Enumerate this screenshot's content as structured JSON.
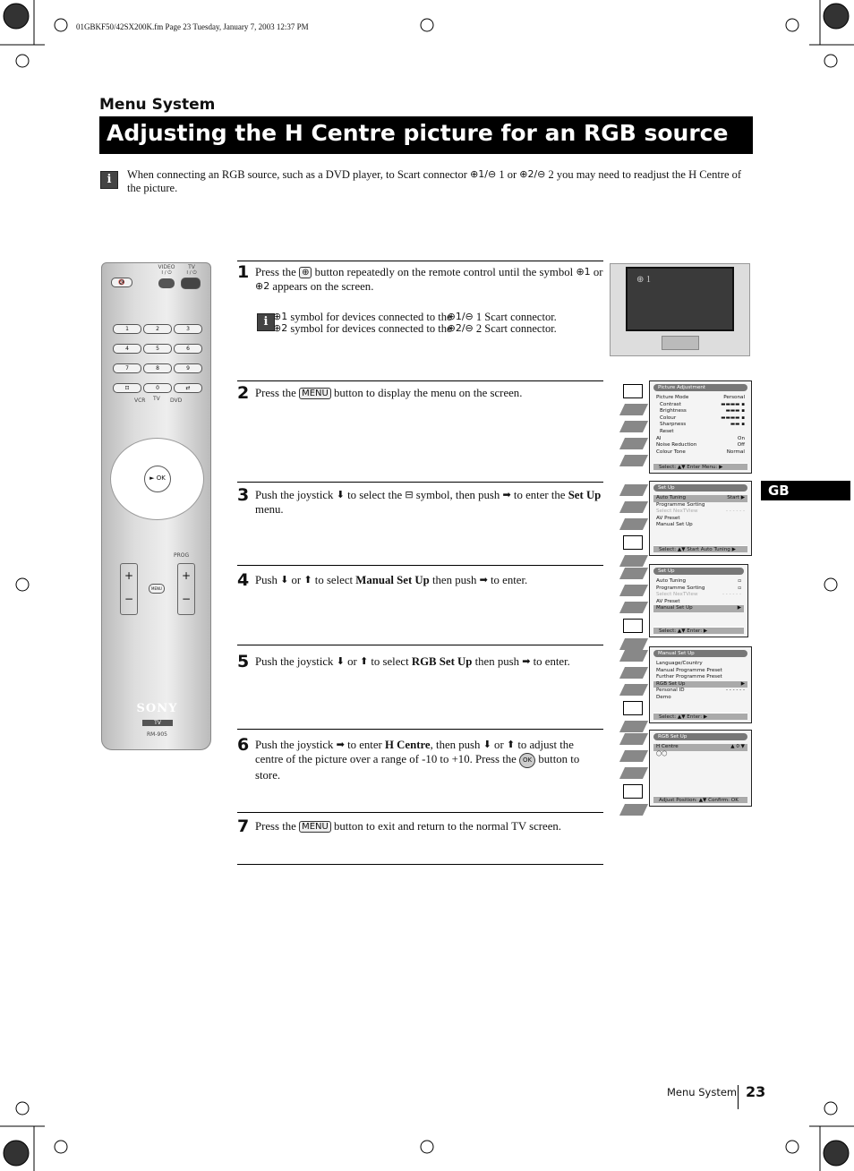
{
  "header": {
    "file_info": "01GBKF50/42SX200K.fm  Page 23  Tuesday, January 7, 2003  12:37 PM",
    "section": "Menu System",
    "title": "Adjusting the H Centre picture for an RGB source"
  },
  "intro": [
    {
      "t": "When connecting an RGB source, such as a DVD player, to Scart connector "
    },
    {
      "i": "scart-1-icon",
      "g": "⊕1/⊖"
    },
    {
      "t": " 1 or "
    },
    {
      "i": "scart-2-icon",
      "g": "⊕2/⊖"
    },
    {
      "t": " 2 you may need to readjust the H Centre of the picture."
    }
  ],
  "steps": [
    {
      "num": "1",
      "parts": [
        {
          "t": "Press the "
        },
        {
          "i": "input-button-icon",
          "g": "⊕",
          "c": "ic"
        },
        {
          "t": " button repeatedly on the remote control until the symbol "
        },
        {
          "i": "input-1-icon",
          "g": "⊕1",
          "c": "sym"
        },
        {
          "t": " or "
        },
        {
          "i": "input-2-icon",
          "g": "⊕2",
          "c": "sym"
        },
        {
          "t": " appears on the screen."
        }
      ]
    },
    {
      "num": "2",
      "parts": [
        {
          "t": "Press the "
        },
        {
          "i": "menu-button-icon",
          "g": "MENU",
          "c": "ic"
        },
        {
          "t": " button to display the menu on the screen."
        }
      ]
    },
    {
      "num": "3",
      "parts": [
        {
          "t": "Push the joystick "
        },
        {
          "i": "joystick-down-icon",
          "g": "⬇",
          "c": "arrow"
        },
        {
          "t": " to select the "
        },
        {
          "i": "toolbox-icon",
          "g": "⊟",
          "c": "sym"
        },
        {
          "t": " symbol, then push "
        },
        {
          "i": "joystick-right-icon",
          "g": "➡",
          "c": "arrow"
        },
        {
          "t": " to enter the "
        },
        {
          "b": "Set Up"
        },
        {
          "t": " menu."
        }
      ]
    },
    {
      "num": "4",
      "parts": [
        {
          "t": "Push "
        },
        {
          "i": "joystick-down-icon",
          "g": "⬇",
          "c": "arrow"
        },
        {
          "t": " or "
        },
        {
          "i": "joystick-up-icon",
          "g": "⬆",
          "c": "arrow"
        },
        {
          "t": " to select "
        },
        {
          "b": "Manual Set Up"
        },
        {
          "t": " then push "
        },
        {
          "i": "joystick-right-icon",
          "g": "➡",
          "c": "arrow"
        },
        {
          "t": " to enter."
        }
      ]
    },
    {
      "num": "5",
      "parts": [
        {
          "t": "Push the joystick "
        },
        {
          "i": "joystick-down-icon",
          "g": "⬇",
          "c": "arrow"
        },
        {
          "t": " or "
        },
        {
          "i": "joystick-up-icon",
          "g": "⬆",
          "c": "arrow"
        },
        {
          "t": " to select "
        },
        {
          "b": "RGB Set Up"
        },
        {
          "t": " then push "
        },
        {
          "i": "joystick-right-icon",
          "g": "➡",
          "c": "arrow"
        },
        {
          "t": " to enter."
        }
      ]
    },
    {
      "num": "6",
      "parts": [
        {
          "t": "Push the joystick "
        },
        {
          "i": "joystick-right-icon",
          "g": "➡",
          "c": "arrow"
        },
        {
          "t": " to enter "
        },
        {
          "b": "H Centre"
        },
        {
          "t": ", then push "
        },
        {
          "i": "joystick-down-icon",
          "g": "⬇",
          "c": "arrow"
        },
        {
          "t": " or "
        },
        {
          "i": "joystick-up-icon",
          "g": "⬆",
          "c": "arrow"
        },
        {
          "t": " to adjust the centre of the picture over a range of -10 to +10. Press the "
        },
        {
          "i": "ok-button-icon",
          "g": "OK",
          "c": "ok"
        },
        {
          "t": " button to store."
        }
      ]
    },
    {
      "num": "7",
      "parts": [
        {
          "t": "Press the "
        },
        {
          "i": "menu-button-icon",
          "g": "MENU",
          "c": "ic"
        },
        {
          "t": " button to exit and return to the normal TV screen."
        }
      ]
    }
  ],
  "note": [
    [
      {
        "i": "input-1-icon",
        "g": "⊕1",
        "c": "sym"
      },
      {
        "t": " symbol for devices connected to the "
      },
      {
        "i": "scart-1-icon",
        "g": "⊕1/⊖",
        "c": "sym"
      },
      {
        "t": " 1 Scart connector."
      }
    ],
    [
      {
        "i": "input-2-icon",
        "g": "⊕2",
        "c": "sym"
      },
      {
        "t": " symbol for devices connected to the "
      },
      {
        "i": "scart-2-icon",
        "g": "⊕2/⊖",
        "c": "sym"
      },
      {
        "t": " 2 Scart connector."
      }
    ]
  ],
  "tv_screen": {
    "symbol": "⊕ 1"
  },
  "menus": [
    {
      "title": "Picture Adjustment",
      "selected_icon": 0,
      "rows": [
        {
          "l": "Picture Mode",
          "v": "Personal"
        },
        {
          "l": "Contrast",
          "v": "▬▬▬▬ ▪",
          "s": "ind"
        },
        {
          "l": "Brightness",
          "v": "▬▬▬ ▪",
          "s": "ind"
        },
        {
          "l": "Colour",
          "v": "▬▬▬▬ ▪",
          "s": "ind"
        },
        {
          "l": "Sharpness",
          "v": "▬▬ ▪",
          "s": "ind"
        },
        {
          "l": "Reset",
          "v": "",
          "s": "ind"
        },
        {
          "l": "AI",
          "v": "On"
        },
        {
          "l": "Noise Reduction",
          "v": "Off"
        },
        {
          "l": "Colour Tone",
          "v": "Normal"
        }
      ],
      "footer": "Select: ▲▼  Enter Menu: ▶"
    },
    {
      "title": "Set Up",
      "selected_icon": 3,
      "rows": [
        {
          "l": "Auto Tuning",
          "v": "Start ▶",
          "s": "hl"
        },
        {
          "l": "Programme Sorting",
          "v": ""
        },
        {
          "l": "Select NexTView",
          "v": "- - - - - -",
          "s": "dim"
        },
        {
          "l": "AV Preset",
          "v": ""
        },
        {
          "l": "Manual Set Up",
          "v": ""
        }
      ],
      "footer": "Select: ▲▼  Start Auto Tuning ▶"
    },
    {
      "title": "Set Up",
      "selected_icon": 3,
      "rows": [
        {
          "l": "Auto Tuning",
          "v": "▫"
        },
        {
          "l": "Programme Sorting",
          "v": "▫"
        },
        {
          "l": "Select NexTView",
          "v": "- - - - - -",
          "s": "dim"
        },
        {
          "l": "AV Preset",
          "v": ""
        },
        {
          "l": "Manual Set Up",
          "v": "▶",
          "s": "hl"
        }
      ],
      "footer": "Select: ▲▼  Enter: ▶"
    },
    {
      "title": "Manual Set Up",
      "selected_icon": 3,
      "rows": [
        {
          "l": "Language/Country",
          "v": ""
        },
        {
          "l": "Manual Programme Preset",
          "v": ""
        },
        {
          "l": "Further Programme Preset",
          "v": ""
        },
        {
          "l": "RGB Set Up",
          "v": "▶",
          "s": "hl"
        },
        {
          "l": "Personal ID",
          "v": "- - - - - -"
        },
        {
          "l": "Demo",
          "v": ""
        }
      ],
      "footer": "Select: ▲▼  Enter: ▶"
    },
    {
      "title": "RGB Set Up",
      "selected_icon": 3,
      "rows": [
        {
          "l": "H Centre",
          "v": "▲ 0 ▼",
          "s": "hl"
        },
        {
          "l": "◯◯",
          "v": ""
        }
      ],
      "footer": "Adjust Position: ▲▼ Confirm: OK"
    }
  ],
  "remote": {
    "video_label": "VIDEO",
    "tv_label": "TV",
    "power": "I / ⏻",
    "keys": [
      "1",
      "2",
      "3",
      "4",
      "5",
      "6",
      "7",
      "8",
      "9",
      "⊡",
      "0",
      "⇄"
    ],
    "vcr": "VCR",
    "tv": "TV",
    "dvd": "DVD",
    "ok": "OK",
    "prog": "PROG",
    "menu": "MENU",
    "brand": "SONY",
    "mode": "TV",
    "model": "RM-905"
  },
  "tab": "GB",
  "footer": {
    "section": "Menu System",
    "page": "23"
  }
}
